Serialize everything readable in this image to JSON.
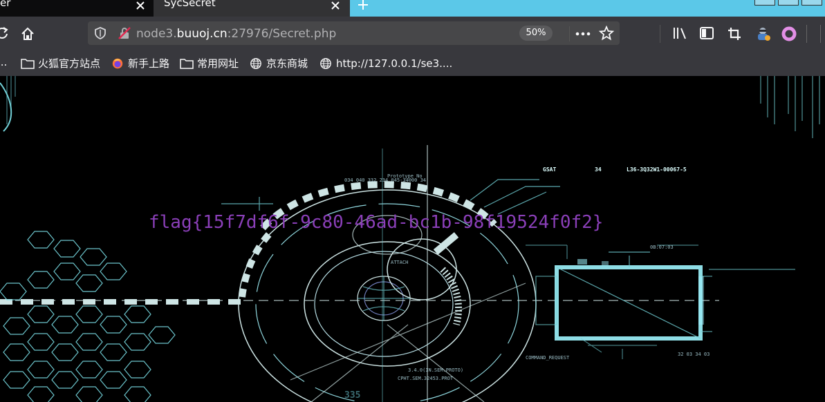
{
  "tabs": [
    {
      "label": "er",
      "active": false
    },
    {
      "label": "SycSecret",
      "active": true
    }
  ],
  "new_tab_label": "+",
  "url": {
    "prefix": "node3.",
    "domain": "buuoj.cn",
    "suffix": ":27976/Secret.php"
  },
  "zoom": "50%",
  "bookmarks": [
    {
      "label": "...",
      "icon": "ellipsis-icon"
    },
    {
      "label": "火狐官方站点",
      "icon": "folder-icon"
    },
    {
      "label": "新手上路",
      "icon": "firefox-icon"
    },
    {
      "label": "常用网址",
      "icon": "folder-icon"
    },
    {
      "label": "京东商城",
      "icon": "globe-icon"
    },
    {
      "label": "http://127.0.0.1/se3....",
      "icon": "globe-icon"
    }
  ],
  "page": {
    "flag": "flag{15f7df6f-9c80-46ad-bc1b-98f19524f0f2}",
    "hud_labels": {
      "gsat": "GSAT",
      "num": "34",
      "code": "L36-3Q32W1-00067-5",
      "bottom": "335"
    }
  },
  "colors": {
    "tabbar": "#5bc8e8",
    "navbar": "#38383d",
    "flag": "#8a3fb8",
    "hud": "#7fe8f0"
  }
}
